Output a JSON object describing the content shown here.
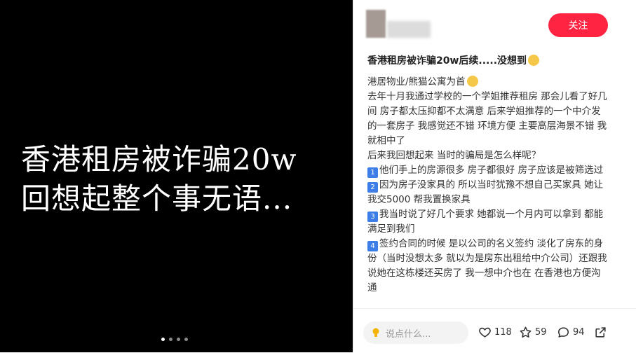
{
  "cover": {
    "line1": "香港租房被诈骗20w",
    "line2": "回想起整个事无语..."
  },
  "carousel": {
    "count": 4,
    "active_index": 0
  },
  "header": {
    "follow_label": "关注"
  },
  "post": {
    "title": "香港租房被诈骗20w后续.....没想到",
    "paragraphs": [
      "港居物业/熊猫公寓为首",
      "去年十月我通过学校的一个学姐推荐租房 那会儿看了好几间 房子都太压抑都不太满意 后来学姐推荐的一个中介发的一套房子 我感觉还不错 环境方便 主要高层海景不错 我就相中了",
      "后来我回想起来 当时的骗局是怎么样呢？"
    ],
    "points": [
      {
        "num": "1",
        "text": "他们手上的房源很多 房子都很好 房子应该是被筛选过"
      },
      {
        "num": "2",
        "text": "因为房子没家具的 所以当时犹豫不想自己买家具 她让我交5000 帮我置换家具"
      },
      {
        "num": "3",
        "text": "我当时说了好几个要求 她都说一个月内可以拿到 都能满足到我们"
      },
      {
        "num": "4",
        "text": "签约合同的时候 是以公司的名义签约 淡化了房东的身份（当时没想太多 就以为是房东出租给中介公司）还跟我说她在这栋楼还买房了 我一想中介也在 在香港也方便沟通"
      }
    ]
  },
  "footer": {
    "comment_placeholder": "说点什么...",
    "likes": "118",
    "stars": "59",
    "comments": "94"
  },
  "colors": {
    "accent": "#ff2442",
    "number_badge": "#3d7de8"
  },
  "icons": [
    "pencil-bulb-icon",
    "heart-icon",
    "star-icon",
    "comment-icon",
    "share-icon"
  ]
}
